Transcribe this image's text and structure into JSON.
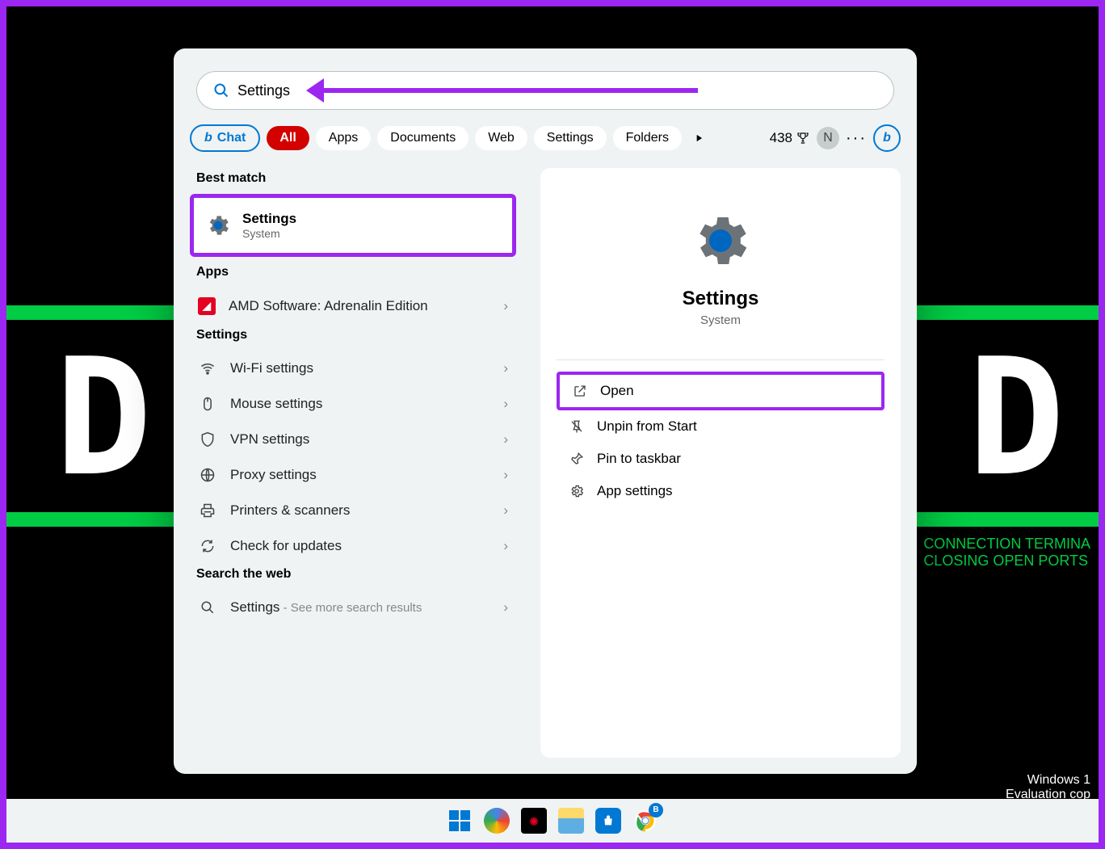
{
  "search": {
    "value": "Settings"
  },
  "filters": {
    "chat": "Chat",
    "all": "All",
    "tabs": [
      "Apps",
      "Documents",
      "Web",
      "Settings",
      "Folders"
    ]
  },
  "rewards": {
    "points": "438"
  },
  "avatar": {
    "initial": "N"
  },
  "left": {
    "best_match_label": "Best match",
    "best_match": {
      "title": "Settings",
      "subtitle": "System"
    },
    "apps_label": "Apps",
    "apps": [
      {
        "name": "AMD Software: Adrenalin Edition"
      }
    ],
    "settings_label": "Settings",
    "settings": [
      {
        "name": "Wi-Fi settings",
        "icon": "wifi"
      },
      {
        "name": "Mouse settings",
        "icon": "mouse"
      },
      {
        "name": "VPN settings",
        "icon": "shield"
      },
      {
        "name": "Proxy settings",
        "icon": "globe"
      },
      {
        "name": "Printers & scanners",
        "icon": "printer"
      },
      {
        "name": "Check for updates",
        "icon": "refresh"
      }
    ],
    "web_label": "Search the web",
    "web": {
      "term": "Settings",
      "suffix": " - See more search results"
    }
  },
  "right": {
    "title": "Settings",
    "subtitle": "System",
    "actions": [
      {
        "label": "Open",
        "icon": "open",
        "highlight": true
      },
      {
        "label": "Unpin from Start",
        "icon": "unpin"
      },
      {
        "label": "Pin to taskbar",
        "icon": "pin"
      },
      {
        "label": "App settings",
        "icon": "gear"
      }
    ]
  },
  "wallpaper": {
    "term1": "CONNECTION TERMINA",
    "term2": "CLOSING OPEN PORTS",
    "wm1": "Windows 1",
    "wm2": "Evaluation cop"
  }
}
